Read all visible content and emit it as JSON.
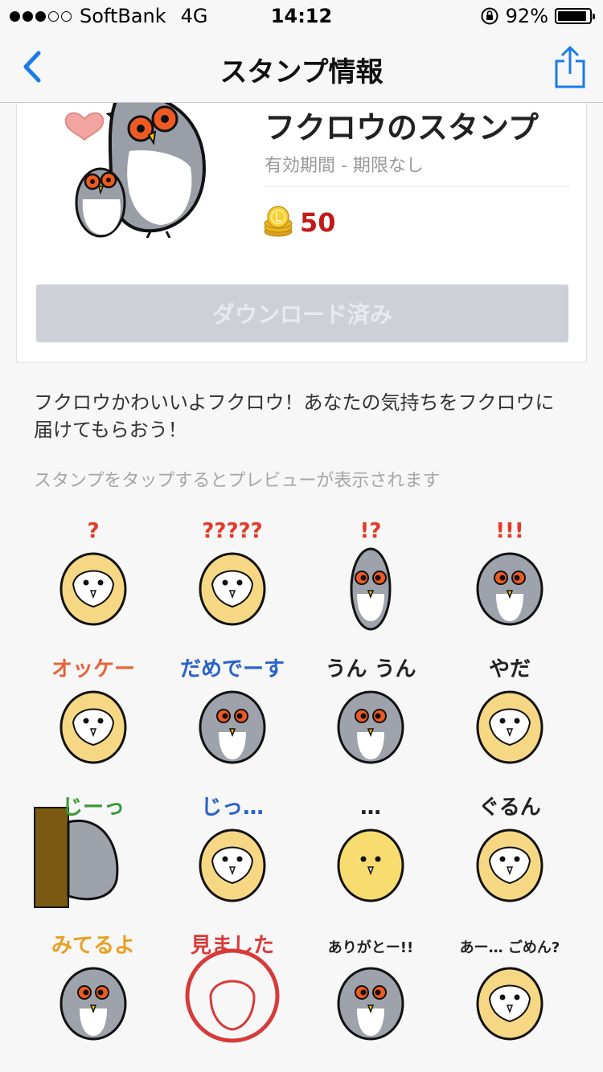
{
  "status_bar": {
    "carrier": "SoftBank",
    "network": "4G",
    "time": "14:12",
    "battery": "92%",
    "battery_level": 0.92,
    "signal_bars": 3,
    "signal_total": 5,
    "icons": [
      "signal-dots-icon",
      "rotation-lock-icon",
      "battery-icon"
    ]
  },
  "nav": {
    "title": "スタンプ情報",
    "back_icon": "chevron-left-icon",
    "share_icon": "share-icon",
    "accent": "#1a7ce8"
  },
  "product": {
    "title": "フクロウのスタンプ",
    "period": "有効期間 - 期限なし",
    "price": "50",
    "price_icon": "coin-icon",
    "price_color": "#c21a1a",
    "download_label": "ダウンロード済み",
    "download_enabled": false
  },
  "description": "フクロウかわいいよフクロウ！あなたの気持ちをフクロウに届けてもらおう！",
  "hint": "スタンプをタップするとプレビューが表示されます",
  "stickers": [
    {
      "caption": "?",
      "owl": "barn",
      "caption_color": "#e23b2a"
    },
    {
      "caption": "?????",
      "owl": "barn",
      "caption_color": "#e23b2a"
    },
    {
      "caption": "!?",
      "owl": "gray-tall",
      "caption_color": "#e23b2a"
    },
    {
      "caption": "!!!",
      "owl": "gray-trio",
      "caption_color": "#e23b2a"
    },
    {
      "caption": "オッケー",
      "owl": "barn-and-gray",
      "caption_color": "#e8623a"
    },
    {
      "caption": "だめでーす",
      "owl": "gray-and-barn",
      "caption_color": "#2a63c8"
    },
    {
      "caption": "うん うん",
      "owl": "gray-nod",
      "caption_color": "#222222"
    },
    {
      "caption": "やだ",
      "owl": "barn-round",
      "caption_color": "#222222"
    },
    {
      "caption": "じーっ",
      "owl": "gray-peek",
      "caption_color": "#3a9a3a"
    },
    {
      "caption": "じっ…",
      "owl": "barn-closeup",
      "caption_color": "#2a63c8"
    },
    {
      "caption": "…",
      "owl": "yellow-bubble",
      "caption_color": "#222222"
    },
    {
      "caption": "ぐるん",
      "owl": "barn-turn",
      "caption_color": "#222222"
    },
    {
      "caption": "みてるよ",
      "owl": "gray-back",
      "caption_color": "#e8a020"
    },
    {
      "caption": "見ました",
      "owl": "stamp-seal",
      "caption_color": "#d83a3a"
    },
    {
      "caption": "ありがとー!!",
      "owl": "gray-thanks",
      "caption_color": "#222222"
    },
    {
      "caption": "あー… ごめん?",
      "owl": "barn-sorry",
      "caption_color": "#222222"
    }
  ]
}
